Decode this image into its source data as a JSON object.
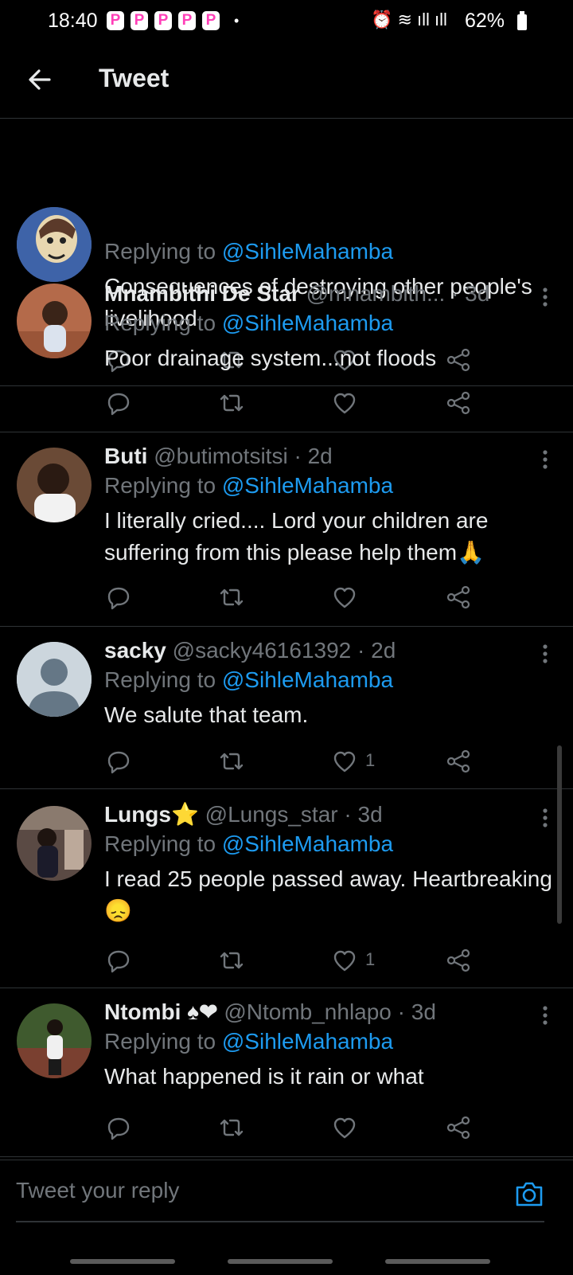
{
  "status_bar": {
    "time": "18:40",
    "notif_badges": [
      "P",
      "P",
      "P",
      "P",
      "P"
    ],
    "dot": "•",
    "icons": "⏰ ≋ ıll ıll",
    "battery": "62%"
  },
  "header": {
    "title": "Tweet"
  },
  "tweets": [
    {
      "name": "",
      "handle": "",
      "time": "",
      "replying_label": "Replying to",
      "replying_to": "@SihleMahamba",
      "text": "Consequences of destroying other people's livelihood",
      "likes": ""
    },
    {
      "name": "Mnambithi De Star",
      "handle": "@mnambith...",
      "time": "· 3d",
      "replying_label": "Replying to",
      "replying_to": "@SihleMahamba",
      "text": "Poor drainage system...not floods",
      "likes": ""
    },
    {
      "name": "Buti",
      "handle": "@butimotsitsi",
      "time": "· 2d",
      "replying_label": "Replying to",
      "replying_to": "@SihleMahamba",
      "text": "I literally cried.... Lord your children are suffering from this please help them🙏",
      "likes": ""
    },
    {
      "name": "sacky",
      "handle": "@sacky46161392",
      "time": "· 2d",
      "replying_label": "Replying to",
      "replying_to": "@SihleMahamba",
      "text": "We salute that team.",
      "likes": "1"
    },
    {
      "name": "Lungs⭐",
      "handle": "@Lungs_star",
      "time": "· 3d",
      "replying_label": "Replying to",
      "replying_to": "@SihleMahamba",
      "text": "I read 25 people passed away. Heartbreaking 😞",
      "likes": "1"
    },
    {
      "name": "Ntombi ♠❤",
      "handle": "@Ntomb_nhlapo",
      "time": "· 3d",
      "replying_label": "Replying to",
      "replying_to": "@SihleMahamba",
      "text": "What happened is it rain or what",
      "likes": ""
    }
  ],
  "reply_box": {
    "placeholder": "Tweet your reply"
  },
  "colors": {
    "accent": "#1d9bf0",
    "background": "#000000",
    "muted": "#71767b",
    "divider": "#2f3336"
  }
}
